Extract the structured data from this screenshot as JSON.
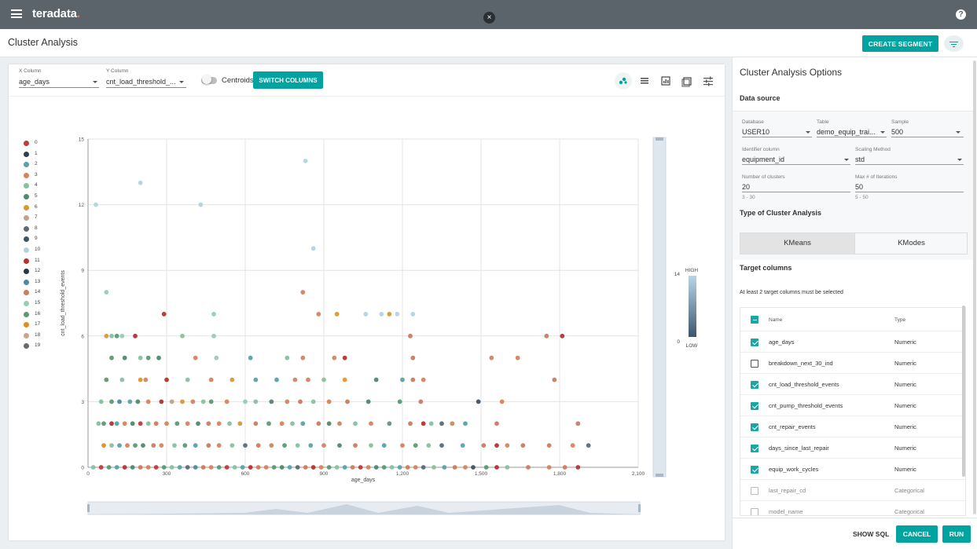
{
  "topbar": {
    "brand": "teradata",
    "brand_dot": ".",
    "close_glyph": "×",
    "help_glyph": "?"
  },
  "header": {
    "title": "Cluster Analysis",
    "create_segment": "CREATE SEGMENT"
  },
  "controls": {
    "x_label": "X Column",
    "x_value": "age_days",
    "y_label": "Y Column",
    "y_value": "cnt_load_threshold_...",
    "centroids_label": "Centroids",
    "centroids_on": false,
    "switch_columns": "SWITCH COLUMNS"
  },
  "icons": [
    "scatter-icon",
    "list-icon",
    "bar-chart-icon",
    "image-icon",
    "sliders-icon"
  ],
  "legend": {
    "labels": [
      "0",
      "1",
      "2",
      "3",
      "4",
      "5",
      "6",
      "7",
      "8",
      "9",
      "10",
      "11",
      "12",
      "13",
      "14",
      "15",
      "16",
      "17",
      "18",
      "19"
    ],
    "colors": [
      "#c23b3b",
      "#2e3f4d",
      "#57a3a6",
      "#d6845f",
      "#86c2a1",
      "#4e8a6c",
      "#d99a2b",
      "#c2a089",
      "#5f6b73",
      "#3e5366",
      "#b5d2e2",
      "#b8312e",
      "#263848",
      "#4d8a9e",
      "#cf7b5c",
      "#96cfb4",
      "#5a9a74",
      "#db8f21",
      "#c7a58b",
      "#6a6a6a"
    ]
  },
  "chart_data": {
    "type": "scatter",
    "xlabel": "age_days",
    "ylabel": "cnt_load_threshold_events",
    "xlim": [
      0,
      2100
    ],
    "ylim": [
      0,
      15
    ],
    "x_ticks": [
      0,
      300,
      600,
      900,
      1200,
      1500,
      1800,
      2100
    ],
    "x_tick_labels": [
      "0",
      "300",
      "600",
      "900",
      "1,200",
      "1,500",
      "1,800",
      "2,100"
    ],
    "y_ticks": [
      0,
      3,
      6,
      9,
      12,
      15
    ],
    "y_tick_labels": [
      "0",
      "3",
      "6",
      "9",
      "12",
      "15"
    ],
    "grid": true,
    "legend_position": "left",
    "color_scale": {
      "high_label": "HIGH",
      "low_label": "LOW",
      "max": "14",
      "min": "0"
    },
    "points": [
      [
        30,
        12,
        10
      ],
      [
        200,
        13,
        10
      ],
      [
        430,
        12,
        10
      ],
      [
        830,
        14,
        10
      ],
      [
        860,
        10,
        10
      ],
      [
        70,
        8,
        15
      ],
      [
        820,
        8,
        3
      ],
      [
        290,
        7,
        11
      ],
      [
        480,
        7,
        15
      ],
      [
        880,
        7,
        3
      ],
      [
        950,
        7,
        6
      ],
      [
        1060,
        7,
        10
      ],
      [
        1120,
        7,
        10
      ],
      [
        1150,
        7,
        6
      ],
      [
        1180,
        7,
        10
      ],
      [
        1240,
        7,
        10
      ],
      [
        70,
        6,
        6
      ],
      [
        90,
        6,
        4
      ],
      [
        110,
        6,
        16
      ],
      [
        130,
        6,
        15
      ],
      [
        180,
        6,
        11
      ],
      [
        360,
        6,
        4
      ],
      [
        480,
        6,
        15
      ],
      [
        1230,
        6,
        14
      ],
      [
        1750,
        6,
        14
      ],
      [
        1810,
        6,
        11
      ],
      [
        90,
        5,
        16
      ],
      [
        140,
        5,
        5
      ],
      [
        200,
        5,
        4
      ],
      [
        230,
        5,
        16
      ],
      [
        270,
        5,
        5
      ],
      [
        410,
        5,
        3
      ],
      [
        490,
        5,
        15
      ],
      [
        620,
        5,
        2
      ],
      [
        760,
        5,
        4
      ],
      [
        820,
        5,
        3
      ],
      [
        940,
        5,
        3
      ],
      [
        980,
        5,
        11
      ],
      [
        1240,
        5,
        14
      ],
      [
        1540,
        5,
        3
      ],
      [
        1640,
        5,
        3
      ],
      [
        70,
        4,
        16
      ],
      [
        130,
        4,
        4
      ],
      [
        200,
        4,
        6
      ],
      [
        220,
        4,
        3
      ],
      [
        300,
        4,
        11
      ],
      [
        380,
        4,
        4
      ],
      [
        470,
        4,
        3
      ],
      [
        550,
        4,
        6
      ],
      [
        640,
        4,
        2
      ],
      [
        720,
        4,
        2
      ],
      [
        790,
        4,
        3
      ],
      [
        840,
        4,
        3
      ],
      [
        900,
        4,
        4
      ],
      [
        980,
        4,
        6
      ],
      [
        1100,
        4,
        5
      ],
      [
        1200,
        4,
        2
      ],
      [
        1240,
        4,
        14
      ],
      [
        1280,
        4,
        3
      ],
      [
        1780,
        4,
        14
      ],
      [
        50,
        3,
        4
      ],
      [
        90,
        3,
        16
      ],
      [
        120,
        3,
        13
      ],
      [
        160,
        3,
        2
      ],
      [
        190,
        3,
        5
      ],
      [
        230,
        3,
        3
      ],
      [
        280,
        3,
        11
      ],
      [
        320,
        3,
        7
      ],
      [
        360,
        3,
        6
      ],
      [
        400,
        3,
        3
      ],
      [
        440,
        3,
        4
      ],
      [
        470,
        3,
        16
      ],
      [
        530,
        3,
        3
      ],
      [
        600,
        3,
        15
      ],
      [
        640,
        3,
        4
      ],
      [
        700,
        3,
        5
      ],
      [
        760,
        3,
        3
      ],
      [
        810,
        3,
        14
      ],
      [
        860,
        3,
        4
      ],
      [
        920,
        3,
        3
      ],
      [
        990,
        3,
        14
      ],
      [
        1070,
        3,
        5
      ],
      [
        1190,
        3,
        16
      ],
      [
        1270,
        3,
        14
      ],
      [
        1490,
        3,
        9
      ],
      [
        1580,
        3,
        3
      ],
      [
        40,
        2,
        4
      ],
      [
        60,
        2,
        16
      ],
      [
        90,
        2,
        11
      ],
      [
        110,
        2,
        2
      ],
      [
        140,
        2,
        3
      ],
      [
        170,
        2,
        5
      ],
      [
        200,
        2,
        0
      ],
      [
        230,
        2,
        4
      ],
      [
        260,
        2,
        14
      ],
      [
        300,
        2,
        3
      ],
      [
        340,
        2,
        16
      ],
      [
        380,
        2,
        3
      ],
      [
        420,
        2,
        5
      ],
      [
        460,
        2,
        14
      ],
      [
        500,
        2,
        3
      ],
      [
        540,
        2,
        4
      ],
      [
        580,
        2,
        6
      ],
      [
        640,
        2,
        14
      ],
      [
        690,
        2,
        16
      ],
      [
        740,
        2,
        3
      ],
      [
        780,
        2,
        4
      ],
      [
        820,
        2,
        2
      ],
      [
        880,
        2,
        14
      ],
      [
        920,
        2,
        5
      ],
      [
        960,
        2,
        3
      ],
      [
        1020,
        2,
        4
      ],
      [
        1080,
        2,
        3
      ],
      [
        1150,
        2,
        16
      ],
      [
        1230,
        2,
        14
      ],
      [
        1280,
        2,
        11
      ],
      [
        1310,
        2,
        4
      ],
      [
        1350,
        2,
        8
      ],
      [
        1390,
        2,
        3
      ],
      [
        1440,
        2,
        2
      ],
      [
        1560,
        2,
        14
      ],
      [
        1870,
        2,
        14
      ],
      [
        60,
        1,
        17
      ],
      [
        90,
        1,
        4
      ],
      [
        120,
        1,
        2
      ],
      [
        150,
        1,
        3
      ],
      [
        180,
        1,
        16
      ],
      [
        210,
        1,
        5
      ],
      [
        250,
        1,
        14
      ],
      [
        280,
        1,
        3
      ],
      [
        330,
        1,
        4
      ],
      [
        370,
        1,
        16
      ],
      [
        410,
        1,
        2
      ],
      [
        460,
        1,
        14
      ],
      [
        500,
        1,
        3
      ],
      [
        550,
        1,
        4
      ],
      [
        600,
        1,
        8
      ],
      [
        650,
        1,
        14
      ],
      [
        700,
        1,
        3
      ],
      [
        750,
        1,
        16
      ],
      [
        800,
        1,
        4
      ],
      [
        850,
        1,
        2
      ],
      [
        900,
        1,
        3
      ],
      [
        960,
        1,
        5
      ],
      [
        1020,
        1,
        14
      ],
      [
        1080,
        1,
        4
      ],
      [
        1130,
        1,
        2
      ],
      [
        1200,
        1,
        3
      ],
      [
        1250,
        1,
        16
      ],
      [
        1300,
        1,
        4
      ],
      [
        1350,
        1,
        8
      ],
      [
        1430,
        1,
        2
      ],
      [
        1510,
        1,
        14
      ],
      [
        1560,
        1,
        11
      ],
      [
        1600,
        1,
        3
      ],
      [
        1660,
        1,
        14
      ],
      [
        1760,
        1,
        14
      ],
      [
        1850,
        1,
        3
      ],
      [
        1910,
        1,
        8
      ],
      [
        20,
        0,
        4
      ],
      [
        50,
        0,
        0
      ],
      [
        80,
        0,
        16
      ],
      [
        110,
        0,
        2
      ],
      [
        140,
        0,
        11
      ],
      [
        170,
        0,
        5
      ],
      [
        200,
        0,
        14
      ],
      [
        230,
        0,
        3
      ],
      [
        260,
        0,
        0
      ],
      [
        290,
        0,
        16
      ],
      [
        320,
        0,
        4
      ],
      [
        350,
        0,
        2
      ],
      [
        380,
        0,
        8
      ],
      [
        410,
        0,
        13
      ],
      [
        440,
        0,
        14
      ],
      [
        470,
        0,
        3
      ],
      [
        500,
        0,
        16
      ],
      [
        530,
        0,
        0
      ],
      [
        560,
        0,
        4
      ],
      [
        590,
        0,
        2
      ],
      [
        620,
        0,
        11
      ],
      [
        650,
        0,
        14
      ],
      [
        680,
        0,
        3
      ],
      [
        710,
        0,
        16
      ],
      [
        740,
        0,
        5
      ],
      [
        770,
        0,
        2
      ],
      [
        800,
        0,
        8
      ],
      [
        830,
        0,
        14
      ],
      [
        860,
        0,
        11
      ],
      [
        890,
        0,
        3
      ],
      [
        920,
        0,
        16
      ],
      [
        950,
        0,
        4
      ],
      [
        980,
        0,
        2
      ],
      [
        1010,
        0,
        14
      ],
      [
        1040,
        0,
        0
      ],
      [
        1070,
        0,
        3
      ],
      [
        1100,
        0,
        5
      ],
      [
        1130,
        0,
        16
      ],
      [
        1160,
        0,
        4
      ],
      [
        1190,
        0,
        2
      ],
      [
        1220,
        0,
        14
      ],
      [
        1250,
        0,
        3
      ],
      [
        1280,
        0,
        8
      ],
      [
        1320,
        0,
        4
      ],
      [
        1360,
        0,
        2
      ],
      [
        1400,
        0,
        14
      ],
      [
        1440,
        0,
        3
      ],
      [
        1470,
        0,
        9
      ],
      [
        1520,
        0,
        16
      ],
      [
        1560,
        0,
        11
      ],
      [
        1600,
        0,
        4
      ],
      [
        1680,
        0,
        14
      ],
      [
        1760,
        0,
        3
      ],
      [
        1820,
        0,
        14
      ],
      [
        1870,
        0,
        11
      ]
    ]
  },
  "right_panel": {
    "title": "Cluster Analysis Options",
    "data_source_label": "Data source",
    "database_label": "Database",
    "database_value": "USER10",
    "table_label": "Table",
    "table_value": "demo_equip_trai...",
    "sample_label": "Sample",
    "sample_value": "500",
    "identifier_label": "Identifier column",
    "identifier_value": "equipment_id",
    "scaling_label": "Scaling Method",
    "scaling_value": "std",
    "clusters_label": "Number of clusters",
    "clusters_value": "20",
    "clusters_hint": "3 - 30",
    "iterations_label": "Max # of Iterations",
    "iterations_value": "50",
    "iterations_hint": "5 - 50",
    "type_label": "Type of Cluster Analysis",
    "kmeans": "KMeans",
    "kmodes": "KModes",
    "target_label": "Target columns",
    "target_note": "At least 2 target columns must be selected",
    "col_header_name": "Name",
    "col_header_type": "Type",
    "columns": [
      {
        "name": "age_days",
        "type": "Numeric",
        "checked": true
      },
      {
        "name": "breakdown_next_30_ind",
        "type": "Numeric",
        "checked": false
      },
      {
        "name": "cnt_load_threshold_events",
        "type": "Numeric",
        "checked": true
      },
      {
        "name": "cnt_pump_threshold_events",
        "type": "Numeric",
        "checked": true
      },
      {
        "name": "cnt_repair_events",
        "type": "Numeric",
        "checked": true
      },
      {
        "name": "days_since_last_repair",
        "type": "Numeric",
        "checked": true
      },
      {
        "name": "equip_work_cycles",
        "type": "Numeric",
        "checked": true
      },
      {
        "name": "last_repair_cd",
        "type": "Categorical",
        "checked": false
      },
      {
        "name": "model_name",
        "type": "Categorical",
        "checked": false
      }
    ],
    "show_sql": "SHOW SQL",
    "cancel": "CANCEL",
    "run": "RUN"
  }
}
